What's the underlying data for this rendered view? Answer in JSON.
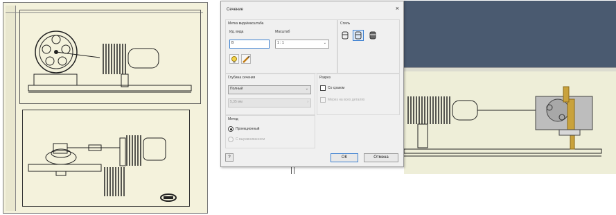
{
  "dialog": {
    "title": "Сечение",
    "close_label": "×",
    "group_label": "Метка вида/масштаба",
    "view_id_label": "Ид. вида",
    "view_id_value": "B",
    "scale_label": "Масштаб",
    "scale_value": "1 : 1",
    "style_label": "Стиль",
    "depth_group_label": "Глубина сечения",
    "depth_value": "Полный",
    "depth_distance": "5,35 мм",
    "cut_group_label": "Разрез",
    "cut_checkbox_label": "Со сраком",
    "cut_all_label": "Мерез на всех деталях",
    "method_group_label": "Метод",
    "method_option1": "Проекционный",
    "method_option2": "С выравниванием",
    "help_label": "?",
    "ok_label": "ОК",
    "cancel_label": "Отмена"
  },
  "colors": {
    "drawing_bg": "#f4f2dc",
    "model_bg_dark": "#4a5a70",
    "model_bg_light": "#eeeed8",
    "brass": "#c9a23c"
  }
}
